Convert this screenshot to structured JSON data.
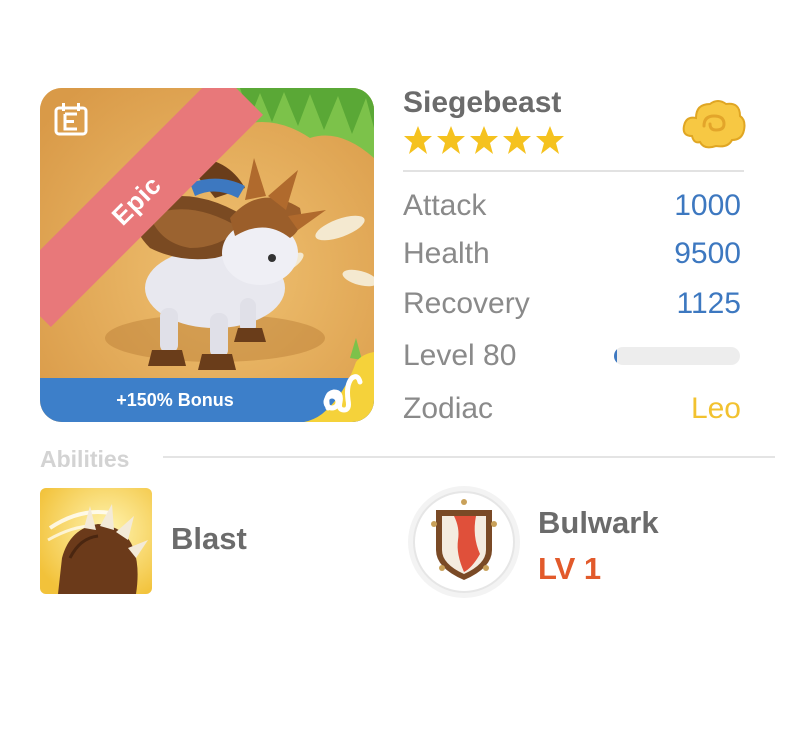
{
  "creature": {
    "rarity": "Epic",
    "bonus": "+150% Bonus",
    "element_icon": "epic-element-icon",
    "zodiac_icon": "leo-icon"
  },
  "info": {
    "name": "Siegebeast",
    "stars": 5,
    "currency_icon": "gold-cloud-icon"
  },
  "stats": {
    "attack": {
      "label": "Attack",
      "value": "1000"
    },
    "health": {
      "label": "Health",
      "value": "9500"
    },
    "recovery": {
      "label": "Recovery",
      "value": "1125"
    },
    "level": {
      "label": "Level 80",
      "progress": 0.02
    },
    "zodiac": {
      "label": "Zodiac",
      "value": "Leo"
    }
  },
  "abilities": {
    "header": "Abilities",
    "items": [
      {
        "name": "Blast",
        "icon": "claw-icon"
      },
      {
        "name": "Bulwark",
        "level": "LV 1",
        "icon": "shield-icon"
      }
    ]
  },
  "colors": {
    "stat_value": "#3d78c0",
    "zodiac_value": "#f2c230",
    "ribbon": "#e8787a",
    "bonus_bar": "#3d7fc9",
    "ability_level": "#e25a2b"
  }
}
